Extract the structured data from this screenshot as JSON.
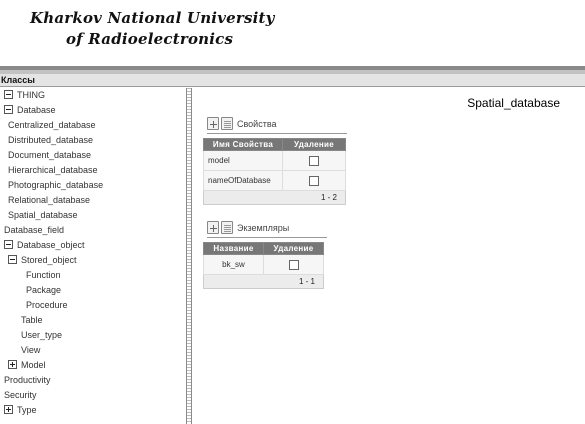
{
  "header": {
    "logo_line1": "Kharkov National University",
    "logo_line2": "of Radioelectronics"
  },
  "classes_bar": {
    "label": "Классы"
  },
  "tree": [
    {
      "label": "THING",
      "toggle": "minus"
    },
    {
      "label": "Database",
      "toggle": "minus"
    },
    {
      "label": "Centralized_database"
    },
    {
      "label": "Distributed_database"
    },
    {
      "label": "Document_database"
    },
    {
      "label": "Hierarchical_database"
    },
    {
      "label": "Photographic_database"
    },
    {
      "label": "Relational_database"
    },
    {
      "label": "Spatial_database"
    },
    {
      "label": "Database_field"
    },
    {
      "label": "Database_object",
      "toggle": "minus"
    },
    {
      "label": "Stored_object",
      "toggle": "minus"
    },
    {
      "label": "Function"
    },
    {
      "label": "Package"
    },
    {
      "label": "Procedure"
    },
    {
      "label": "Table"
    },
    {
      "label": "User_type"
    },
    {
      "label": "View"
    },
    {
      "label": "Model",
      "toggle": "plus"
    },
    {
      "label": "Productivity"
    },
    {
      "label": "Security"
    },
    {
      "label": "Type",
      "toggle": "plus"
    }
  ],
  "main": {
    "title": "Spatial_database",
    "properties": {
      "heading": "Свойства",
      "columns": [
        "Имя Свойства",
        "Удаление"
      ],
      "rows": [
        {
          "name": "model",
          "delete_checked": false
        },
        {
          "name": "nameOfDatabase",
          "delete_checked": false
        }
      ],
      "pager": "1 - 2"
    },
    "instances": {
      "heading": "Экземпляры",
      "columns": [
        "Название",
        "Удаление"
      ],
      "rows": [
        {
          "name": "bk_sw",
          "delete_checked": false
        }
      ],
      "pager": "1 - 1"
    }
  }
}
